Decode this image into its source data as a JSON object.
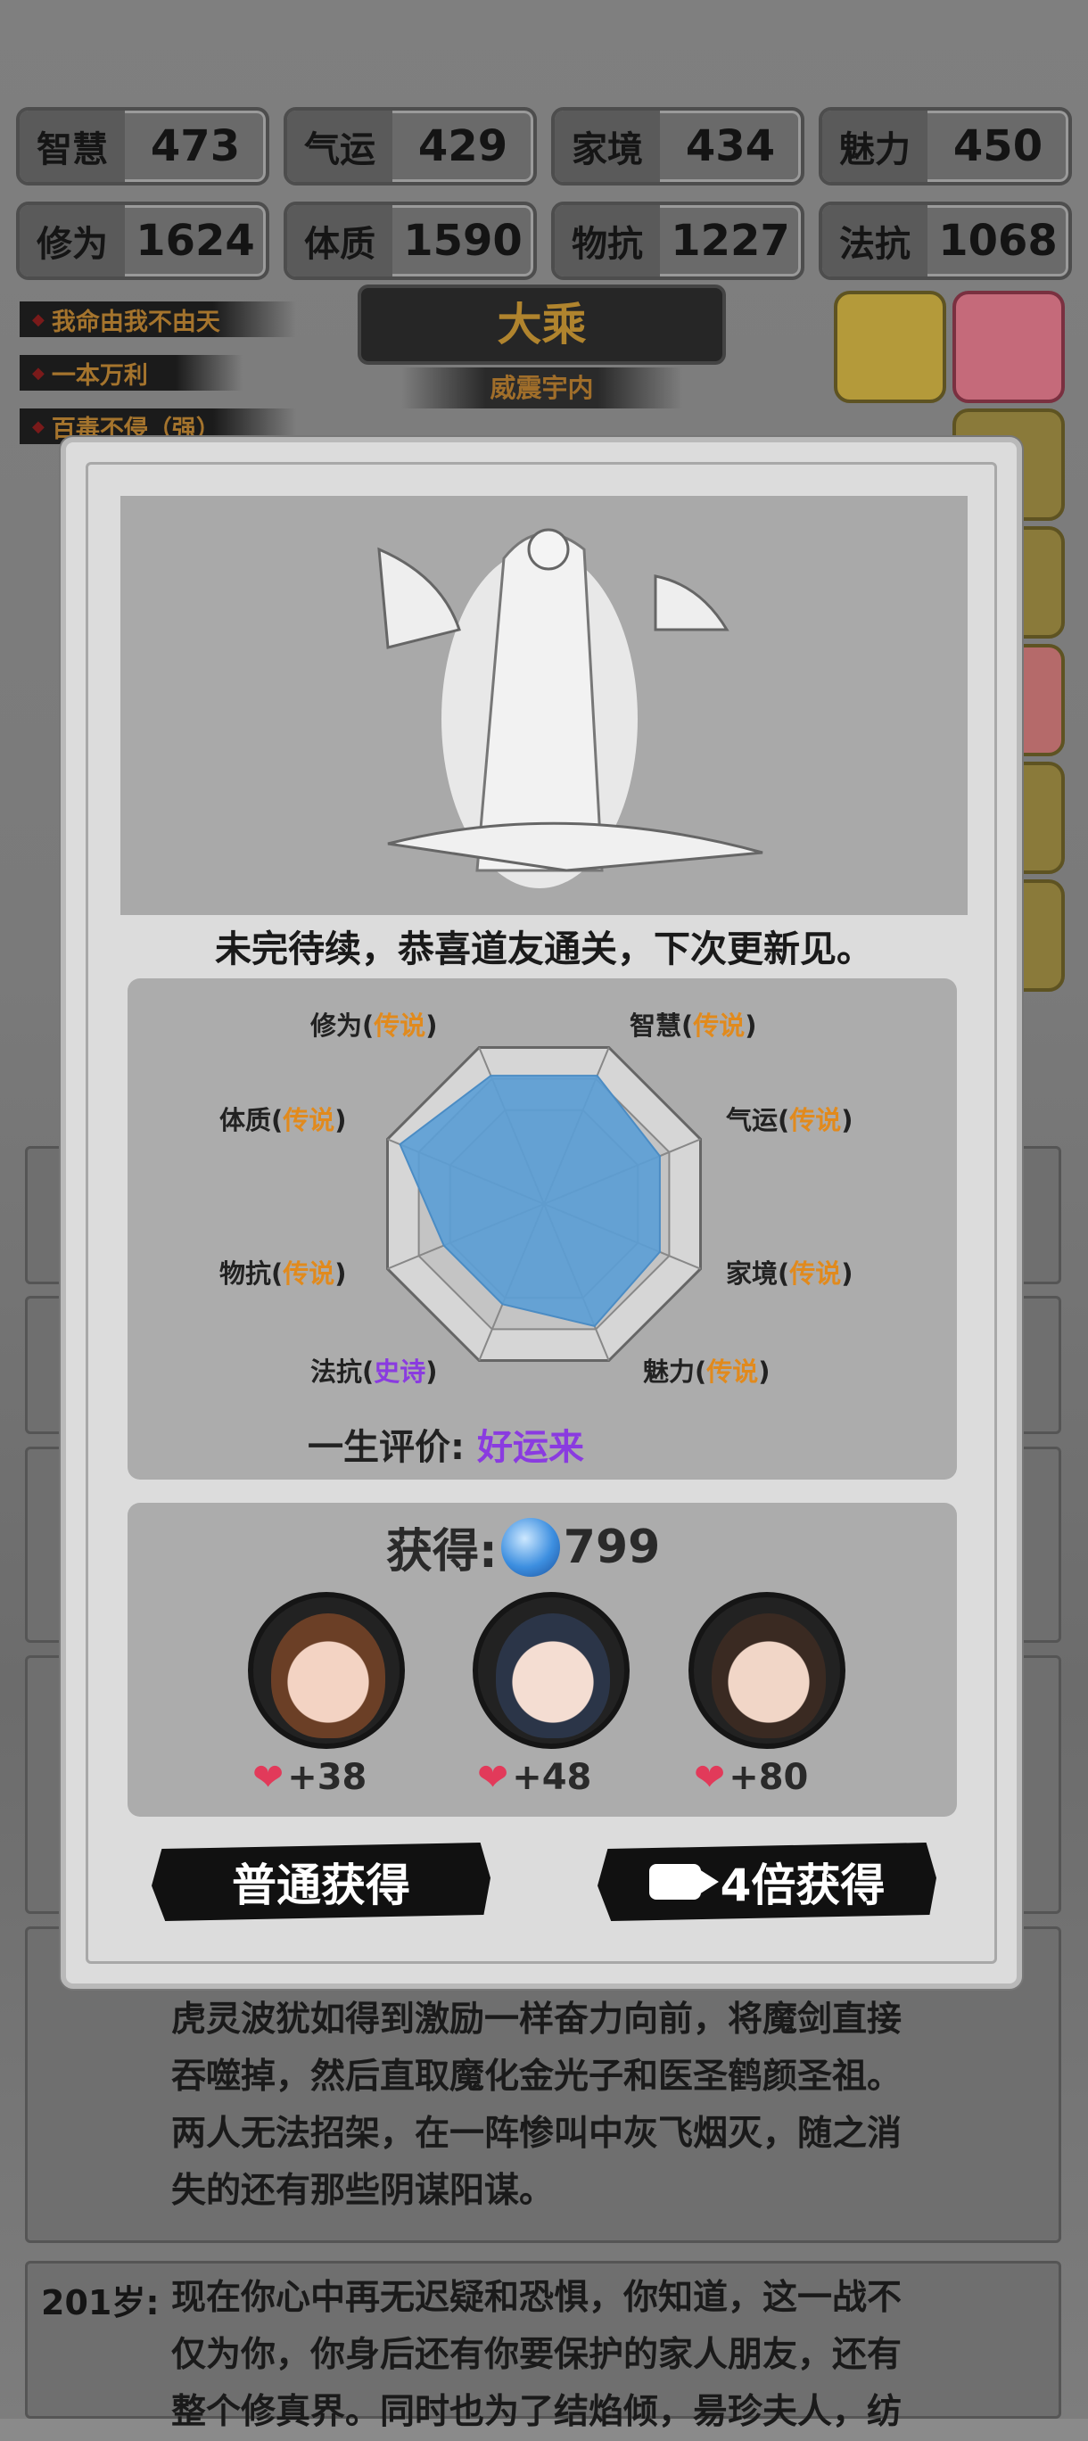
{
  "stats": [
    {
      "label": "智慧",
      "value": "473"
    },
    {
      "label": "气运",
      "value": "429"
    },
    {
      "label": "家境",
      "value": "434"
    },
    {
      "label": "魅力",
      "value": "450"
    },
    {
      "label": "修为",
      "value": "1624"
    },
    {
      "label": "体质",
      "value": "1590"
    },
    {
      "label": "物抗",
      "value": "1227"
    },
    {
      "label": "法抗",
      "value": "1068"
    }
  ],
  "traits": [
    "我命由我不由天",
    "一本万利",
    "百毒不侵（强）"
  ],
  "realm": {
    "title": "大乘",
    "subtitle": "威震宇内"
  },
  "log": [
    {
      "text_lines": [
        "虎灵波犹如得到激励一样奋力向前，将魔剑直接",
        "吞噬掉，然后直取魔化金光子和医圣鹤颜圣祖。",
        "两人无法招架，在一阵惨叫中灰飞烟灭，随之消",
        "失的还有那些阴谋阳谋。"
      ]
    },
    {
      "age": "201岁:",
      "text_lines": [
        "现在你心中再无迟疑和恐惧，你知道，这一战不",
        "仅为你，你身后还有你要保护的家人朋友，还有",
        "整个修真界。同时也为了结焰倾，昜珍夫人，纺"
      ]
    }
  ],
  "modal": {
    "caption": "未完待续，恭喜道友通关，下次更新见。",
    "radar": {
      "labels": [
        {
          "name": "修为",
          "grade": "传说"
        },
        {
          "name": "智慧",
          "grade": "传说"
        },
        {
          "name": "气运",
          "grade": "传说"
        },
        {
          "name": "家境",
          "grade": "传说"
        },
        {
          "name": "魅力",
          "grade": "传说"
        },
        {
          "name": "法抗",
          "grade": "史诗"
        },
        {
          "name": "物抗",
          "grade": "传说"
        },
        {
          "name": "体质",
          "grade": "传说"
        }
      ],
      "values": [
        0.82,
        0.82,
        0.74,
        0.74,
        0.78,
        0.64,
        0.64,
        0.92
      ]
    },
    "evaluation": {
      "label": "一生评价:",
      "value": "好运来"
    },
    "reward": {
      "label": "获得:",
      "amount": "799"
    },
    "companions": [
      {
        "favor": "+38"
      },
      {
        "favor": "+48"
      },
      {
        "favor": "+80"
      }
    ],
    "buttons": {
      "normal": "普通获得",
      "ad": "4倍获得"
    }
  },
  "colors": {
    "legend_grade": "#e18a1d",
    "epic_grade": "#8a3be0",
    "radar_fill": "#5b9fd6"
  }
}
